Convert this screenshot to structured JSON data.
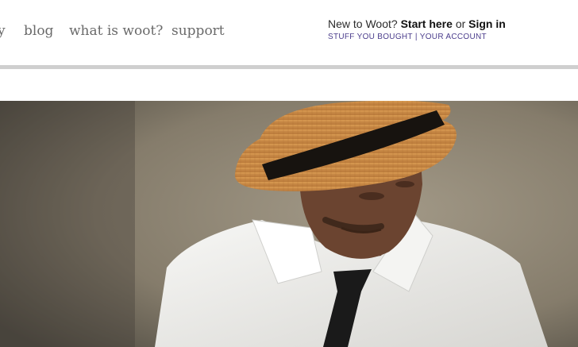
{
  "nav": {
    "items": [
      {
        "label": "y"
      },
      {
        "label": "blog"
      },
      {
        "label": "what is woot?"
      },
      {
        "label": "support"
      }
    ]
  },
  "account": {
    "intro": "New to Woot?",
    "start_here": "Start here",
    "or": "or",
    "sign_in": "Sign in",
    "stuff_you_bought": "STUFF YOU BOUGHT",
    "separator": "|",
    "your_account": "YOUR ACCOUNT"
  },
  "colors": {
    "account_links": "#4b3d8c",
    "divider": "#cfcfcf",
    "nav_text": "#6a6a6a"
  },
  "hero": {
    "icon": "man-in-fedora-photo"
  }
}
